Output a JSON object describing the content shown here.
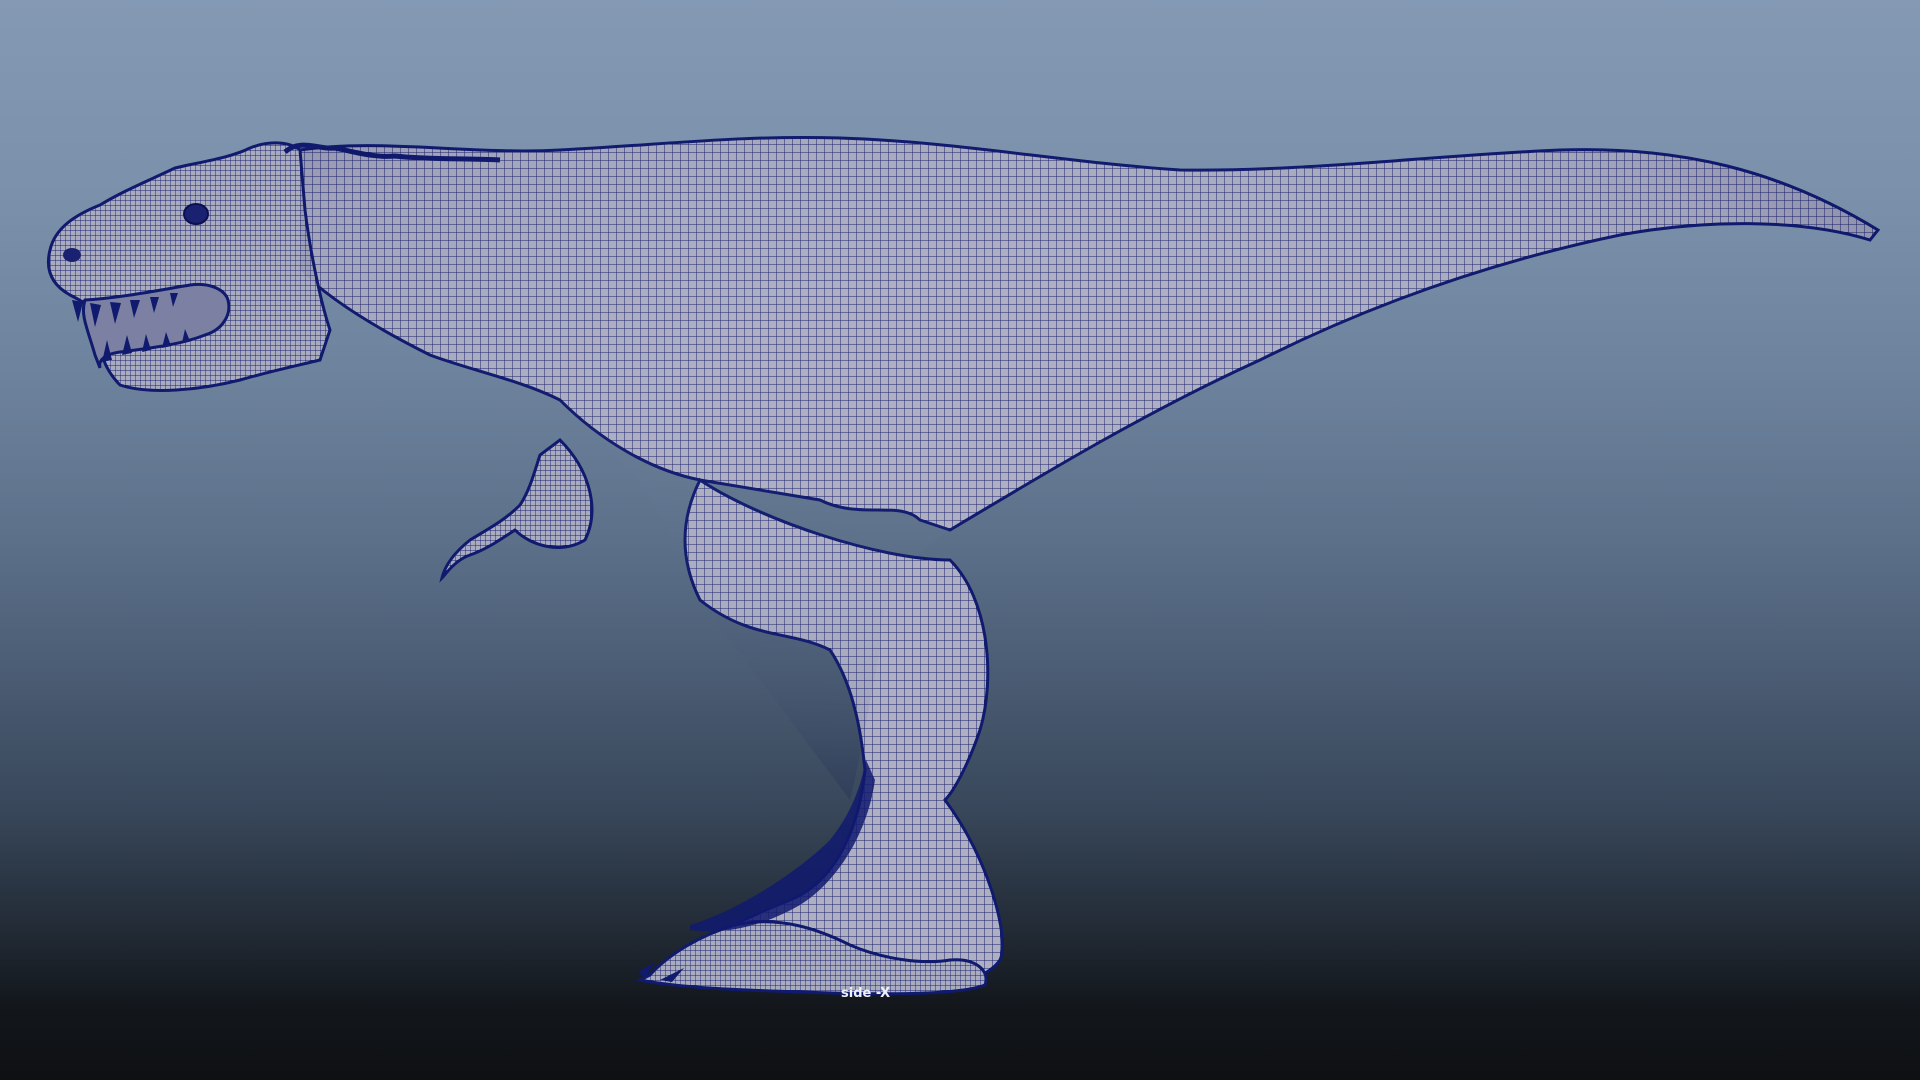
{
  "viewport": {
    "camera_label": "side -X",
    "display_mode": "wireframe-on-shaded",
    "background_top_color": "#8499b3",
    "background_bottom_color": "#0e1013",
    "mesh_fill_color": "#aeb0c2",
    "wire_color": "#101a6e"
  },
  "model": {
    "subject": "tyrannosaurus-mesh",
    "view_facing": "left"
  }
}
